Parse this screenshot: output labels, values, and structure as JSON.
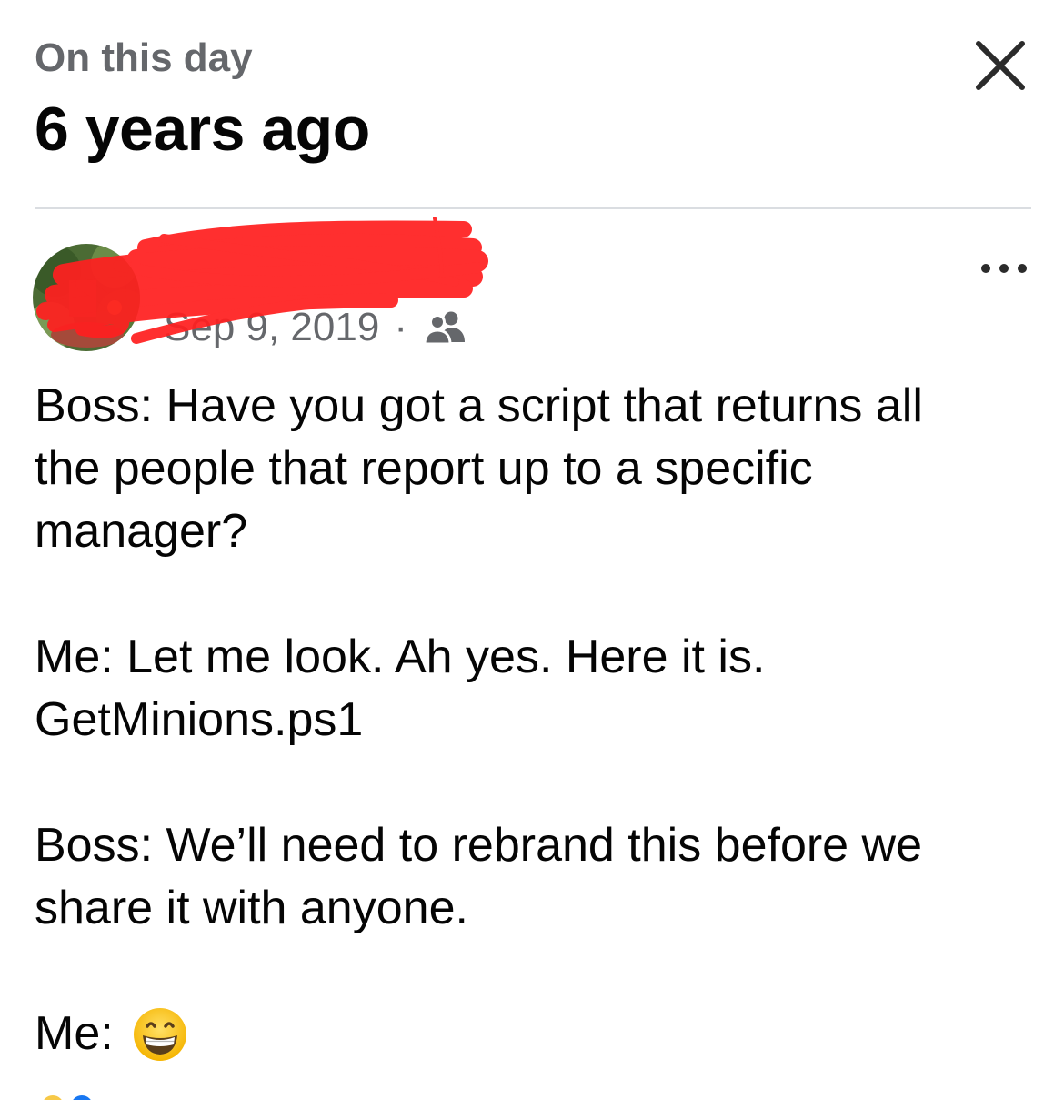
{
  "header": {
    "eyebrow": "On this day",
    "title": "6 years ago",
    "close_icon": "close-icon"
  },
  "post": {
    "author_name": "",
    "author_name_redacted": true,
    "date": "Sep 9, 2019",
    "separator": "·",
    "audience_icon": "friends-icon",
    "more_icon": "more-horizontal-icon",
    "lines": [
      "Boss: Have you got a script that returns all",
      "the people that report up to a specific",
      "manager?",
      "",
      "Me: Let me look. Ah yes. Here it is.",
      "GetMinions.ps1",
      "",
      "Boss: We’ll need to rebrand this before we",
      "share it with anyone.",
      ""
    ],
    "last_line_prefix": "Me:",
    "last_line_emoji": "grinning-face-emoji"
  },
  "colors": {
    "text_primary": "#050505",
    "text_secondary": "#65676b",
    "divider": "#dadde1",
    "redaction": "#ff2020"
  }
}
